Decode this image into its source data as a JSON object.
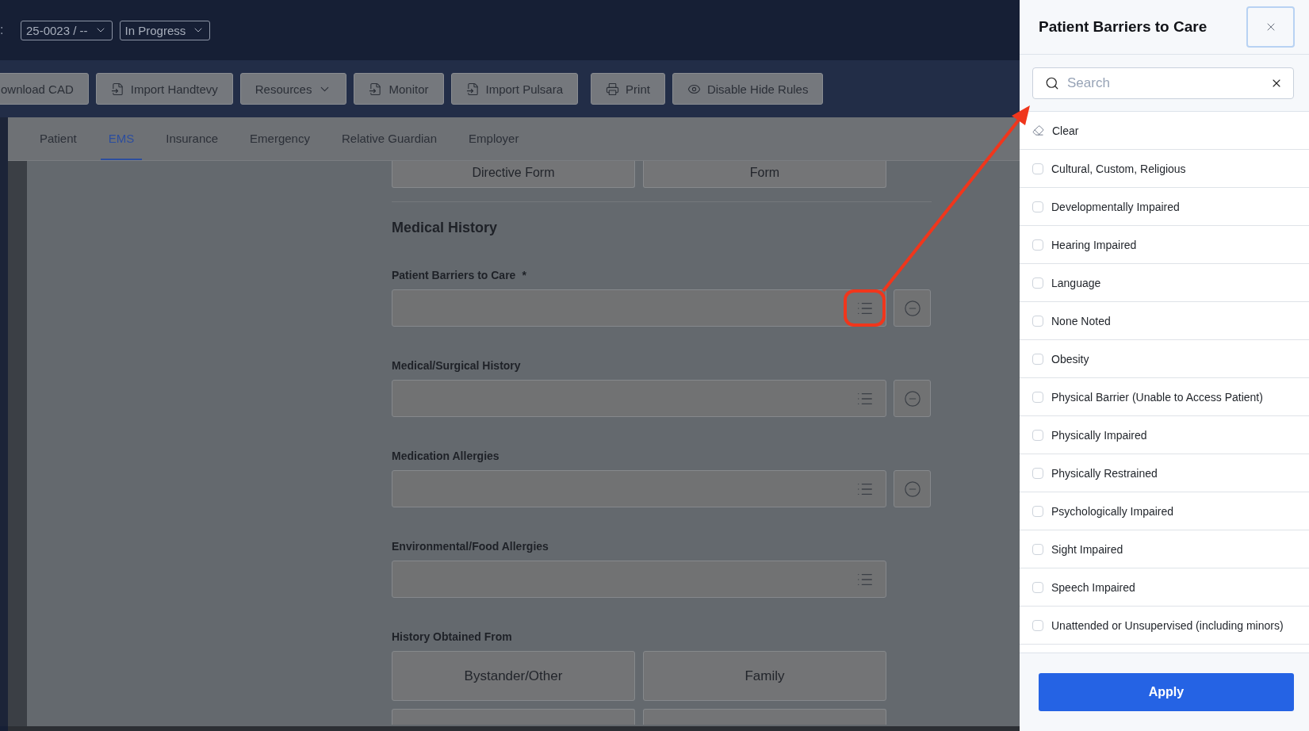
{
  "header": {
    "prefix": ":",
    "selectors": [
      {
        "value": "25-0023 / --"
      },
      {
        "value": "In Progress"
      }
    ]
  },
  "toolbar": {
    "buttons": [
      {
        "label": "ownload CAD",
        "kind": "plain"
      },
      {
        "label": "Import Handtevy",
        "kind": "import"
      },
      {
        "label": "Resources",
        "kind": "dropdown"
      },
      {
        "label": "Monitor",
        "kind": "import"
      },
      {
        "label": "Import Pulsara",
        "kind": "import"
      },
      {
        "label": "Print",
        "kind": "print"
      },
      {
        "label": "Disable Hide Rules",
        "kind": "view"
      }
    ]
  },
  "tabs": [
    {
      "label": "Patient",
      "selected": false
    },
    {
      "label": "EMS",
      "selected": true
    },
    {
      "label": "Insurance",
      "selected": false
    },
    {
      "label": "Emergency",
      "selected": false
    },
    {
      "label": "Relative Guardian",
      "selected": false
    },
    {
      "label": "Employer",
      "selected": false
    }
  ],
  "form": {
    "top_options": [
      "Directive Form",
      "Form"
    ],
    "section_title": "Medical History",
    "fields": [
      {
        "label": "Patient Barriers to Care",
        "required_mark": "*",
        "removable": true,
        "highlighted": true
      },
      {
        "label": "Medical/Surgical History",
        "removable": true,
        "highlighted": false
      },
      {
        "label": "Medication Allergies",
        "removable": true,
        "highlighted": false
      },
      {
        "label": "Environmental/Food Allergies",
        "removable": false,
        "highlighted": false
      }
    ],
    "history": {
      "label": "History Obtained From",
      "options": [
        "Bystander/Other",
        "Family"
      ]
    }
  },
  "drawer": {
    "title": "Patient Barriers to Care",
    "search": {
      "placeholder": "Search"
    },
    "clear_label": "Clear",
    "options": [
      {
        "label": "Cultural, Custom, Religious",
        "checked": false
      },
      {
        "label": "Developmentally Impaired",
        "checked": false
      },
      {
        "label": "Hearing Impaired",
        "checked": false
      },
      {
        "label": "Language",
        "checked": false
      },
      {
        "label": "None Noted",
        "checked": false
      },
      {
        "label": "Obesity",
        "checked": false
      },
      {
        "label": "Physical Barrier (Unable to Access Patient)",
        "checked": false
      },
      {
        "label": "Physically Impaired",
        "checked": false
      },
      {
        "label": "Physically Restrained",
        "checked": false
      },
      {
        "label": "Psychologically Impaired",
        "checked": false
      },
      {
        "label": "Sight Impaired",
        "checked": false
      },
      {
        "label": "Speech Impaired",
        "checked": false
      },
      {
        "label": "Unattended or Unsupervised (including minors)",
        "checked": false
      }
    ],
    "apply_label": "Apply"
  }
}
